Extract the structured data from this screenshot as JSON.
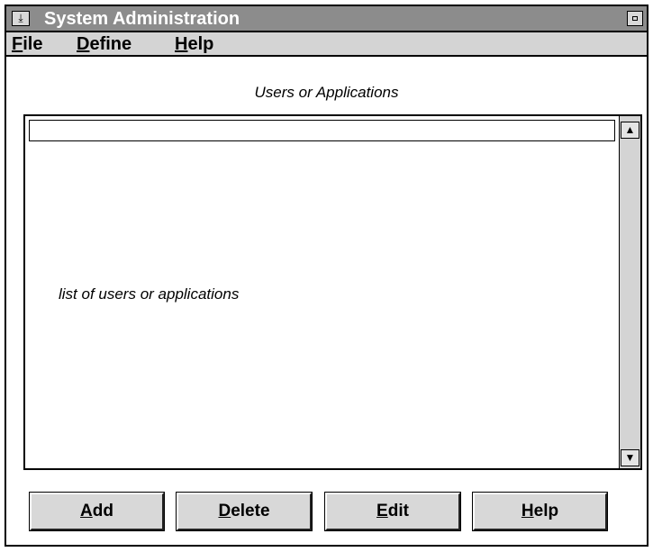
{
  "window": {
    "title": "System Administration",
    "system_menu_glyph": "⤓",
    "system_menu_icon": "window-menu-icon",
    "maximize_icon": "maximize-icon"
  },
  "menubar": {
    "items": [
      {
        "mnemonic": "F",
        "rest": "ile"
      },
      {
        "mnemonic": "D",
        "rest": "efine"
      },
      {
        "mnemonic": "H",
        "rest": "elp"
      }
    ]
  },
  "list": {
    "caption": "Users or Applications",
    "placeholder": "list of users or applications",
    "scroll_up_glyph": "▲",
    "scroll_down_glyph": "▼",
    "scroll_up_icon": "scroll-up-icon",
    "scroll_down_icon": "scroll-down-icon"
  },
  "buttons": [
    {
      "mnemonic": "A",
      "rest": "dd"
    },
    {
      "mnemonic": "D",
      "rest": "elete"
    },
    {
      "mnemonic": "E",
      "rest": "dit"
    },
    {
      "mnemonic": "H",
      "rest": "elp"
    }
  ],
  "colors": {
    "titlebar": "#8c8c8c",
    "menubar": "#d4d4d4",
    "button_face": "#d8d8d8",
    "title_text": "#ffffff"
  }
}
